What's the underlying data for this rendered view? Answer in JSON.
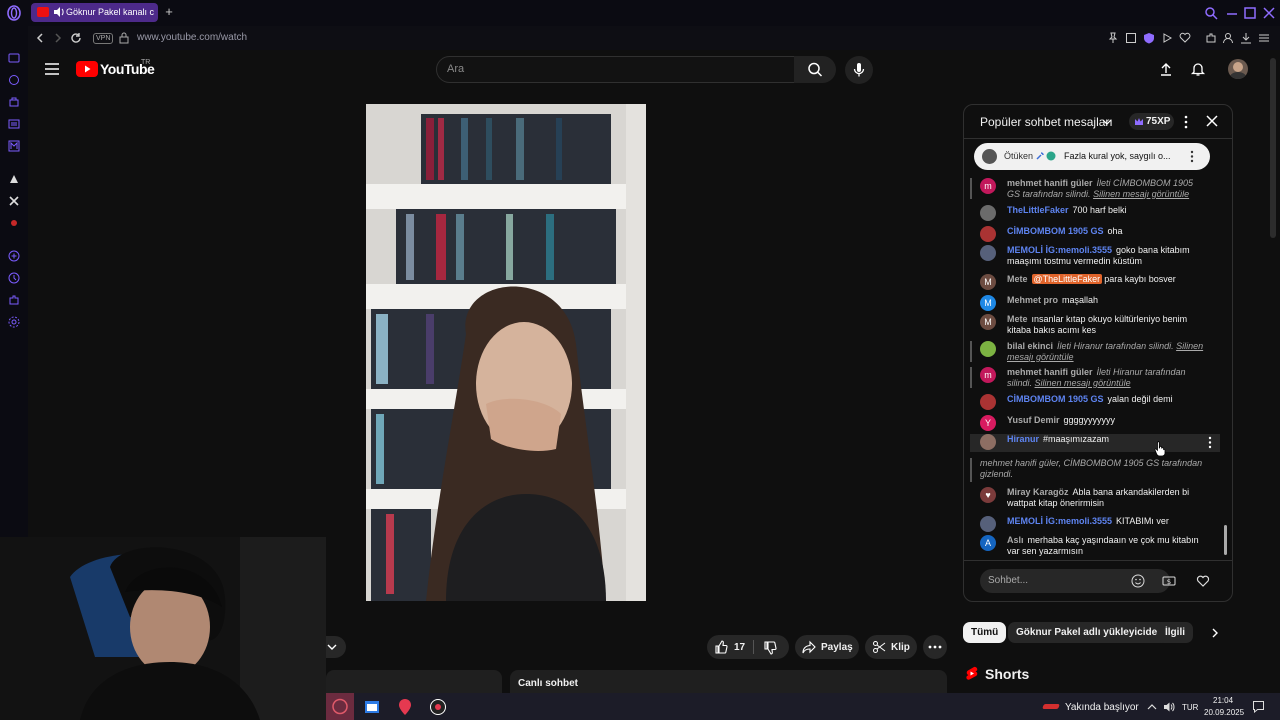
{
  "browser": {
    "tab_title": "Göknur Pakel kanalı c",
    "url": "www.youtube.com/watch",
    "vpn": "VPN"
  },
  "youtube": {
    "logo": "YouTube",
    "country": "TR",
    "search_placeholder": "Ara"
  },
  "video_actions": {
    "likes": "17",
    "share": "Paylaş",
    "clip": "Klip",
    "live_chat_label": "Canlı sohbet"
  },
  "chat": {
    "title": "Popüler sohbet mesajları",
    "xp": "75XP",
    "pinned": {
      "author": "Ötüken",
      "text": "Fazla kural yok, saygılı o..."
    },
    "input_placeholder": "Sohbet...",
    "messages": [
      {
        "author": "mehmet hanifi güler",
        "text": "İleti CİMBOMBOM 1905 GS tarafından silindi.",
        "link": "Silinen mesajı görüntüle",
        "deleted": true,
        "avatar": "m",
        "color": "#c2185b"
      },
      {
        "author": "TheLittleFaker",
        "text": "700 harf belki",
        "avatar": "",
        "color": "#6b6b6b",
        "blue": true
      },
      {
        "author": "CİMBOMBOM 1905 GS",
        "text": "oha",
        "avatar": "",
        "color": "#a33",
        "blue": true
      },
      {
        "author": "MEMOLİ İG:memoli.3555",
        "text": "goko bana kitabım maaşımı tostmu vermedin küstüm",
        "avatar": "",
        "color": "#56607a",
        "blue": true
      },
      {
        "author": "Mete",
        "mention": "@TheLittleFaker",
        "text": "para kaybı bosver",
        "avatar": "M",
        "color": "#6d4c41"
      },
      {
        "author": "Mehmet pro",
        "text": "maşallah",
        "avatar": "M",
        "color": "#1e88e5"
      },
      {
        "author": "Mete",
        "text": "ınsanlar kıtap okuyo kültürleniyo benim kitaba bakıs acımı kes",
        "avatar": "M",
        "color": "#6d4c41"
      },
      {
        "author": "bilal ekinci",
        "text": "İleti Hiranur tarafından silindi.",
        "link": "Silinen mesajı görüntüle",
        "deleted": true,
        "avatar": "",
        "color": "#7cb342"
      },
      {
        "author": "mehmet hanifi güler",
        "text": "İleti Hiranur tarafından silindi.",
        "link": "Silinen mesajı görüntüle",
        "deleted": true,
        "avatar": "m",
        "color": "#c2185b"
      },
      {
        "author": "CİMBOMBOM 1905 GS",
        "text": "yalan değil demi",
        "avatar": "",
        "color": "#a33",
        "blue": true
      },
      {
        "author": "Yusuf Demir",
        "text": "ggggyyyyyyy",
        "avatar": "Y",
        "color": "#d81b60"
      },
      {
        "author": "Hiranur",
        "text": "#maaşımızazam",
        "avatar": "",
        "color": "#8d6e63",
        "blue": true,
        "hover": true
      },
      {
        "system": true,
        "text": "mehmet hanifi güler, CİMBOMBOM 1905 GS tarafından gizlendi."
      },
      {
        "author": "Miray Karagöz",
        "text": "Abla bana arkandakilerden bi wattpat kitap önerirmisin",
        "avatar": "♥",
        "color": "#7b3b3b"
      },
      {
        "author": "MEMOLİ İG:memoli.3555",
        "text": "KITABIMı ver",
        "avatar": "",
        "color": "#56607a",
        "blue": true
      },
      {
        "author": "Aslı",
        "text": "merhaba kaç yaşındaaın ve çok mu kitabın var sen yazarmısın",
        "avatar": "A",
        "color": "#1565c0"
      }
    ]
  },
  "chips": [
    "Tümü",
    "Göknur Pakel adlı yükleyiciden",
    "İlgili"
  ],
  "shorts": "Shorts",
  "taskbar": {
    "weather": "Yakında başlıyor",
    "lang": "TUR",
    "time": "21:04",
    "date": "20.09.2025"
  }
}
